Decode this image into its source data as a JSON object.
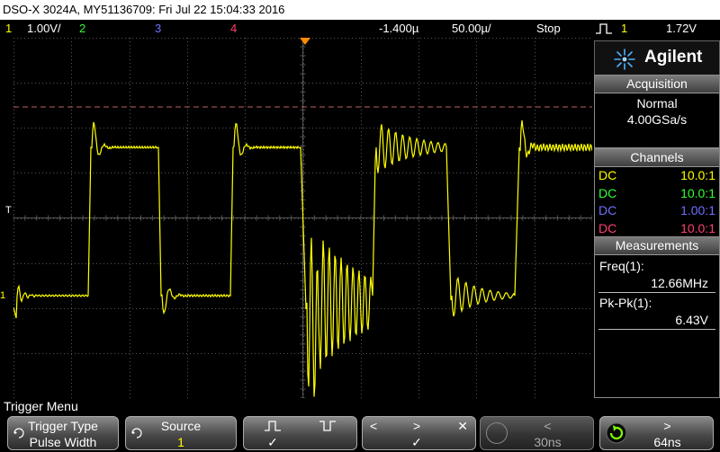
{
  "title": "DSO-X 3024A, MY51136709: Fri Jul 22 15:04:33 2016",
  "status": {
    "ch1_num": "1",
    "ch1_scale": "1.00V/",
    "ch2_num": "2",
    "ch3_num": "3",
    "ch4_num": "4",
    "time_offset": "-1.400µ",
    "time_scale": "50.00µ/",
    "run_state": "Stop",
    "trig_source": "1",
    "trig_level": "1.72V"
  },
  "colors": {
    "ch1": "#ffff00",
    "ch2": "#33ff33",
    "ch3": "#6f6fff",
    "ch4": "#ff3f6f",
    "grid": "#444444",
    "trigger_marker": "#ff8c00",
    "limit_line": "#c06060"
  },
  "markers": {
    "trigger_label": "T",
    "ch1_ground": "1"
  },
  "brand": {
    "name": "Agilent",
    "logo_icon": "spark-icon"
  },
  "acquisition": {
    "header": "Acquisition",
    "mode": "Normal",
    "rate": "4.00GSa/s"
  },
  "channels": {
    "header": "Channels",
    "rows": [
      {
        "coupling": "DC",
        "probe": "10.0:1",
        "color": "#ffff00"
      },
      {
        "coupling": "DC",
        "probe": "10.0:1",
        "color": "#33ff33"
      },
      {
        "coupling": "DC",
        "probe": "1.00:1",
        "color": "#6f6fff"
      },
      {
        "coupling": "DC",
        "probe": "10.0:1",
        "color": "#ff3f6f"
      }
    ]
  },
  "measurements": {
    "header": "Measurements",
    "items": [
      {
        "label": "Freq(1):",
        "value": "12.66MHz"
      },
      {
        "label": "Pk-Pk(1):",
        "value": "6.43V"
      }
    ]
  },
  "menu_title": "Trigger Menu",
  "softkeys": {
    "trigger_type": {
      "label": "Trigger Type",
      "value": "Pulse Width"
    },
    "source": {
      "label": "Source",
      "value": "1"
    },
    "polarity": {
      "check": "✓"
    },
    "qualifier": {
      "lt": "<",
      "gt": ">",
      "x": "✕",
      "check": "✓"
    },
    "time_lower": {
      "arrow": "<",
      "value": "30ns"
    },
    "time_upper": {
      "arrow": ">",
      "value": "64ns"
    }
  }
}
